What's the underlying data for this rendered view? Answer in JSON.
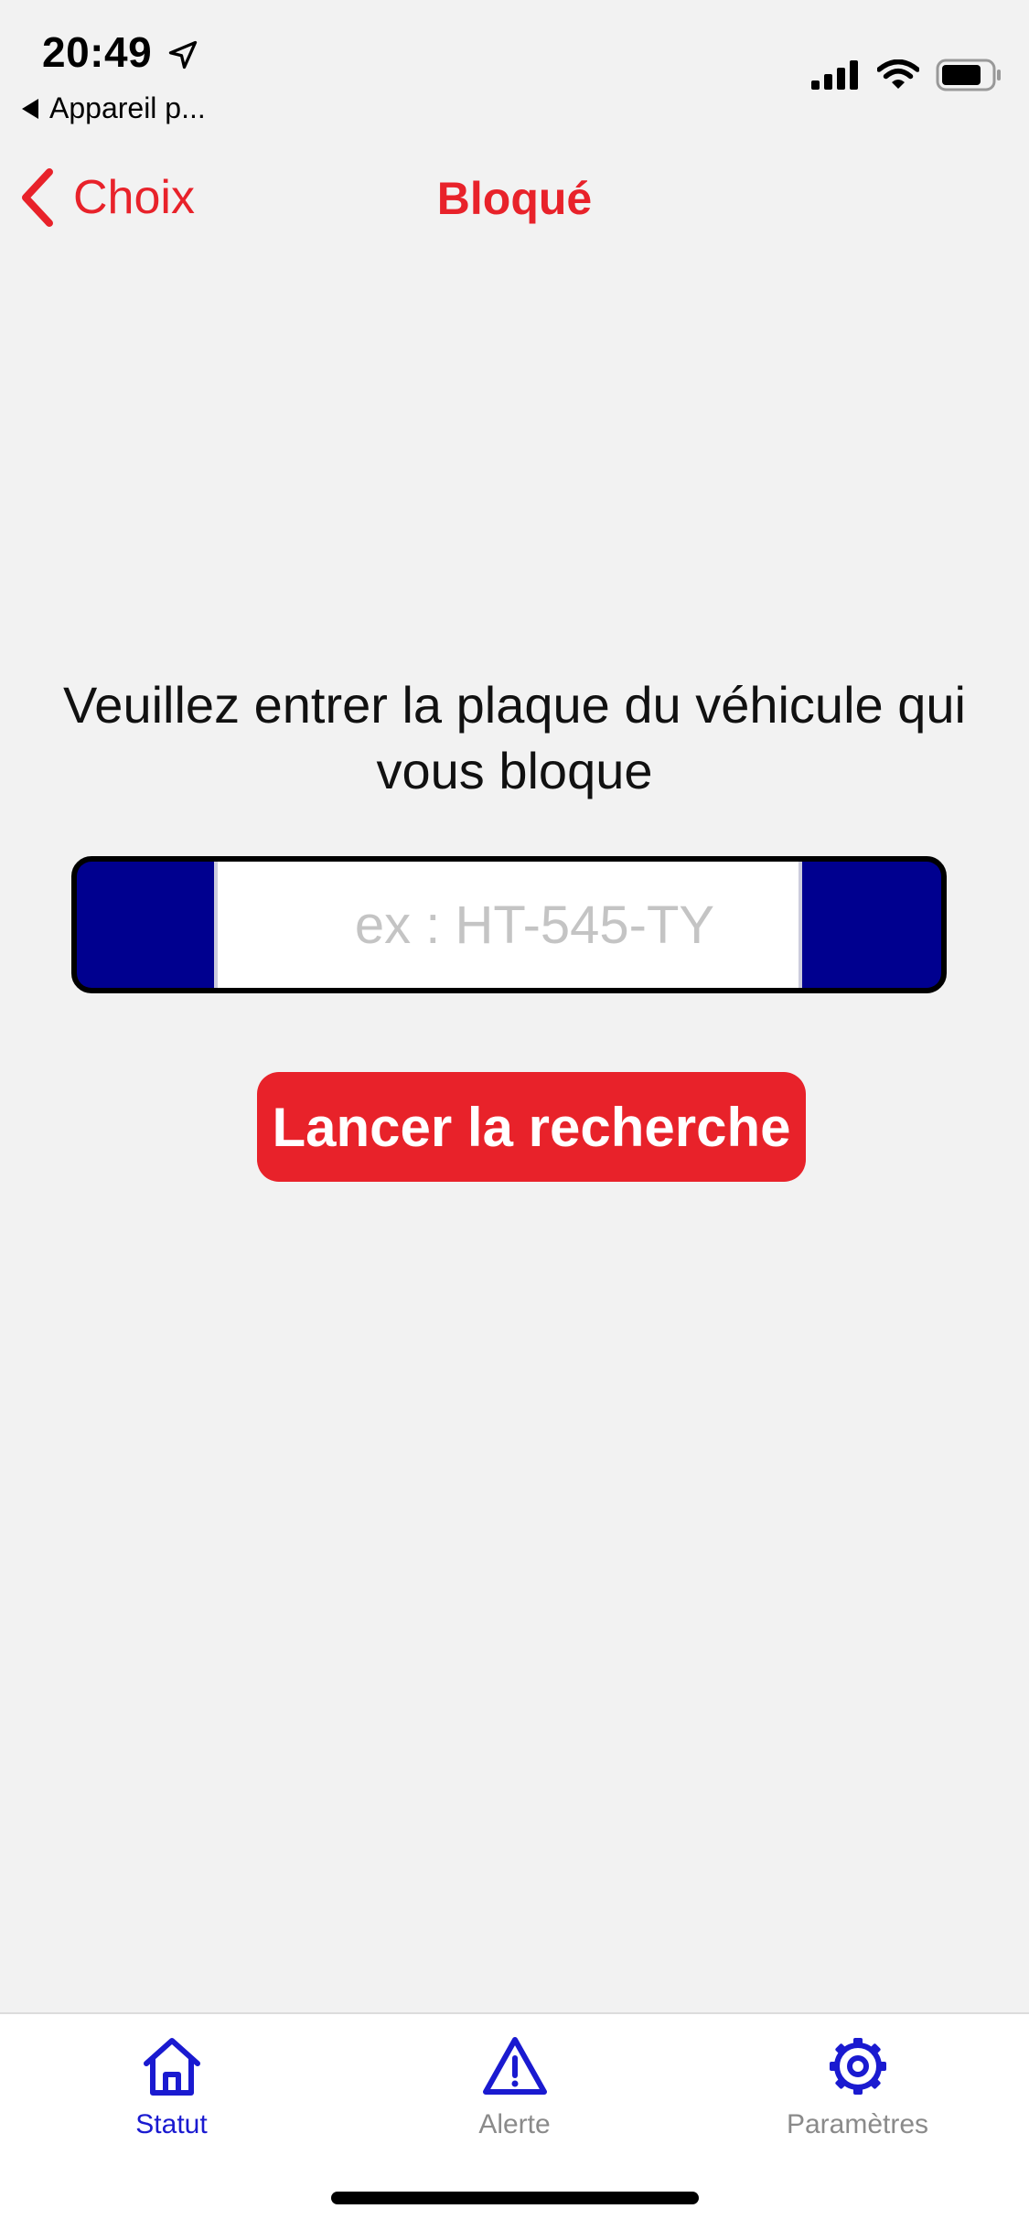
{
  "status_bar": {
    "time": "20:49",
    "back_app_label": "Appareil p..."
  },
  "nav": {
    "back_label": "Choix",
    "title": "Bloqué",
    "accent_color": "#e8222a"
  },
  "main": {
    "prompt": "Veuillez entrer la plaque du véhicule qui vous bloque",
    "plate_input": {
      "value": "",
      "placeholder": "ex : HT-545-TY"
    },
    "search_button_label": "Lancer la recherche"
  },
  "tab_bar": {
    "tabs": [
      {
        "label": "Statut",
        "icon": "home-icon",
        "active": true
      },
      {
        "label": "Alerte",
        "icon": "warning-icon",
        "active": false
      },
      {
        "label": "Paramètres",
        "icon": "gear-icon",
        "active": false
      }
    ],
    "active_color": "#1a1ad0",
    "inactive_color": "#8a8a8a"
  }
}
